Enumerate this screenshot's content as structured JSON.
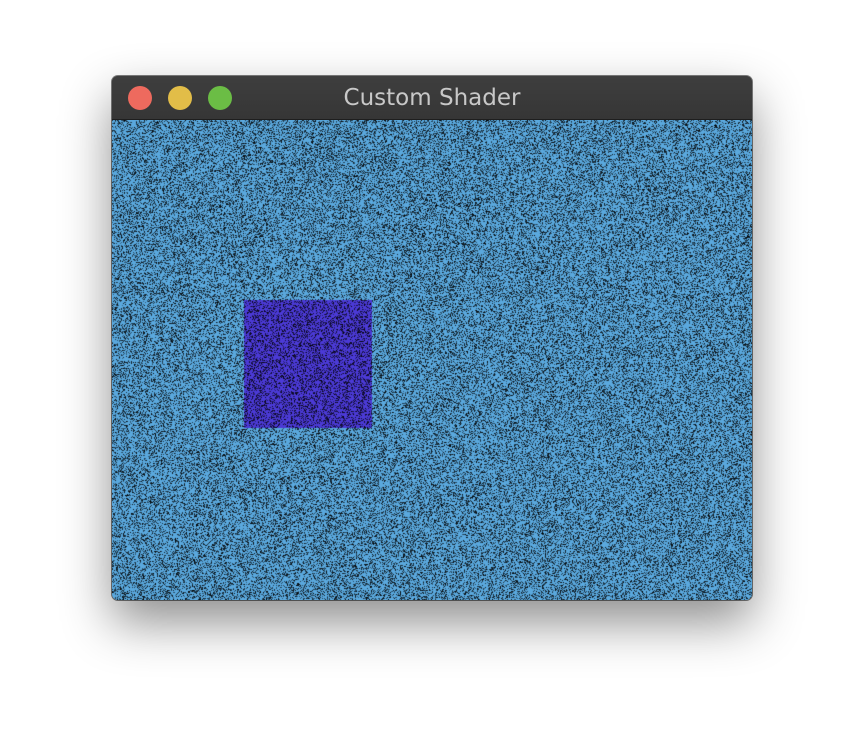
{
  "window": {
    "title": "Custom Shader",
    "controls": {
      "close_color": "#ee6a5e",
      "minimize_color": "#e2bd48",
      "zoom_color": "#6bbd45"
    }
  },
  "canvas": {
    "background_color": "#5aa8dd",
    "square_color": "#4b3ad6",
    "noise_color": "#000000"
  }
}
